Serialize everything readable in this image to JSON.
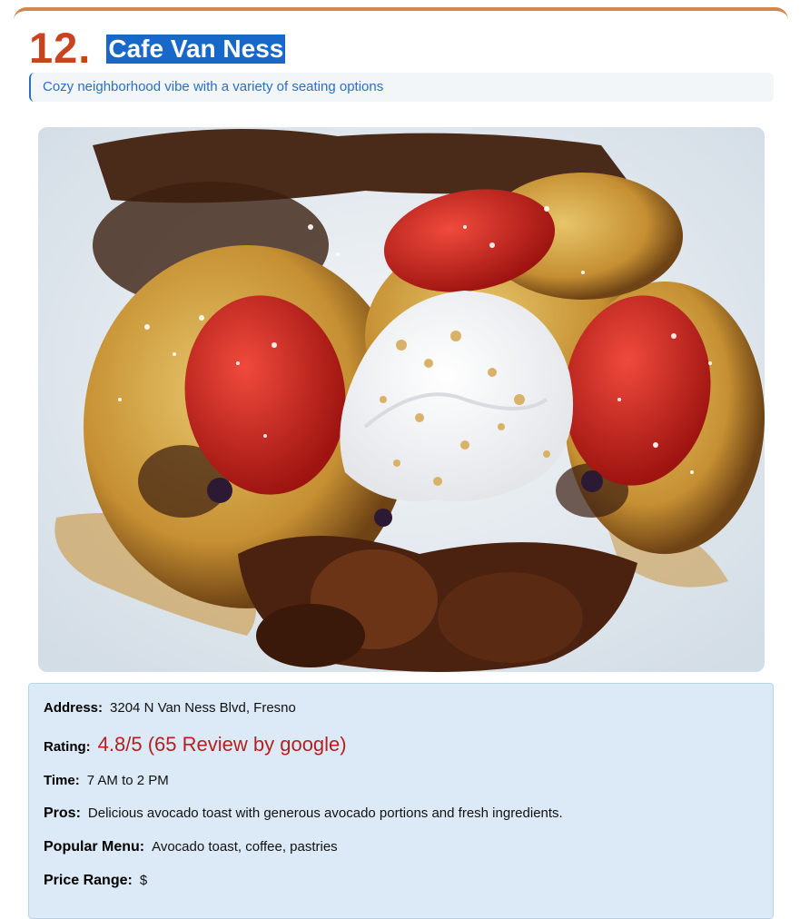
{
  "listing": {
    "rank": "12.",
    "name": "Cafe Van Ness",
    "subtitle": "Cozy neighborhood vibe with a variety of seating options"
  },
  "photo": {
    "subject": "french-toast-with-strawberries-and-whipped-cream"
  },
  "details": {
    "address_label": "Address:",
    "address": "3204 N Van Ness Blvd, Fresno",
    "rating_label": "Rating:",
    "rating": "4.8/5 (65 Review by google)",
    "time_label": "Time:",
    "time": "7 AM to 2 PM",
    "pros_label": "Pros:",
    "pros": "Delicious avocado toast with generous avocado portions and fresh ingredients.",
    "menu_label": "Popular Menu:",
    "menu": "Avocado toast, coffee, pastries",
    "price_label": "Price Range:",
    "price": "$"
  },
  "colors": {
    "accent": "#d4874a",
    "rank": "#c8431f",
    "name_highlight": "#1768c9",
    "subtitle": "#2a6fc2",
    "info_bg": "#dbeaf6",
    "rating": "#b52020"
  }
}
